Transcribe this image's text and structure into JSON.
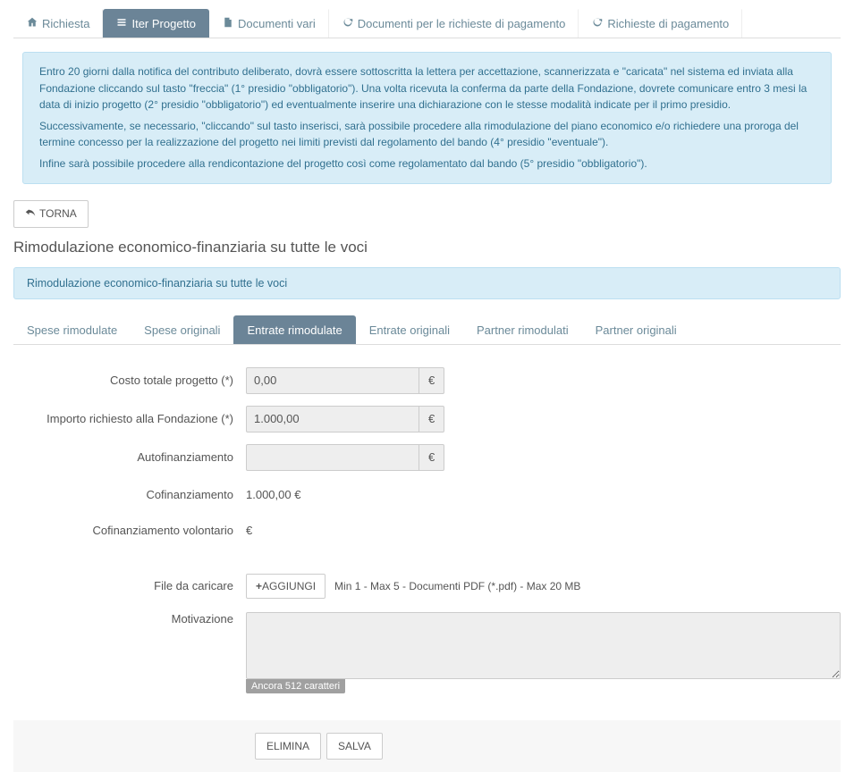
{
  "nav": {
    "items": [
      {
        "label": "Richiesta",
        "icon": "home"
      },
      {
        "label": "Iter Progetto",
        "icon": "list",
        "active": true
      },
      {
        "label": "Documenti vari",
        "icon": "file"
      },
      {
        "label": "Documenti per le richieste di pagamento",
        "icon": "refresh"
      },
      {
        "label": "Richieste di pagamento",
        "icon": "refresh"
      }
    ]
  },
  "alert": {
    "p1": "Entro 20 giorni dalla notifica del contributo deliberato, dovrà essere sottoscritta la lettera per accettazione, scannerizzata e \"caricata\" nel sistema ed inviata alla Fondazione cliccando sul tasto \"freccia\" (1° presidio \"obbligatorio\"). Una volta ricevuta la conferma da parte della Fondazione, dovrete comunicare entro 3 mesi la data di inizio progetto (2° presidio \"obbligatorio\") ed eventualmente inserire una dichiarazione con le stesse modalità indicate per il primo presidio.",
    "p2": "Successivamente, se necessario, \"cliccando\" sul tasto inserisci, sarà possibile procedere alla rimodulazione del piano economico e/o richiedere una proroga del termine concesso per la realizzazione del progetto nei limiti previsti dal regolamento del bando (4° presidio \"eventuale\").",
    "p3": "Infine sarà possibile procedere alla rendicontazione del progetto così come regolamentato dal bando (5° presidio \"obbligatorio\")."
  },
  "buttons": {
    "torna": "TORNA",
    "aggiungi": "AGGIUNGI",
    "elimina": "ELIMINA",
    "salva": "SALVA"
  },
  "section_title": "Rimodulazione economico-finanziaria su tutte le voci",
  "panel_heading": "Rimodulazione economico-finanziaria su tutte le voci",
  "subtabs": {
    "items": [
      {
        "label": "Spese rimodulate"
      },
      {
        "label": "Spese originali"
      },
      {
        "label": "Entrate rimodulate",
        "active": true
      },
      {
        "label": "Entrate originali"
      },
      {
        "label": "Partner rimodulati"
      },
      {
        "label": "Partner originali"
      }
    ]
  },
  "form": {
    "costo_label": "Costo totale progetto (*)",
    "costo_value": "0,00",
    "importo_label": "Importo richiesto alla Fondazione (*)",
    "importo_value": "1.000,00",
    "autofin_label": "Autofinanziamento",
    "autofin_value": "",
    "cofin_label": "Cofinanziamento",
    "cofin_value": "1.000,00 €",
    "cofin_vol_label": "Cofinanziamento volontario",
    "cofin_vol_value": "€",
    "file_label": "File da caricare",
    "file_hint": "Min 1 - Max 5 - Documenti PDF (*.pdf) - Max 20 MB",
    "motivazione_label": "Motivazione",
    "motivazione_value": "",
    "char_counter": "Ancora 512 caratteri",
    "currency": "€"
  }
}
